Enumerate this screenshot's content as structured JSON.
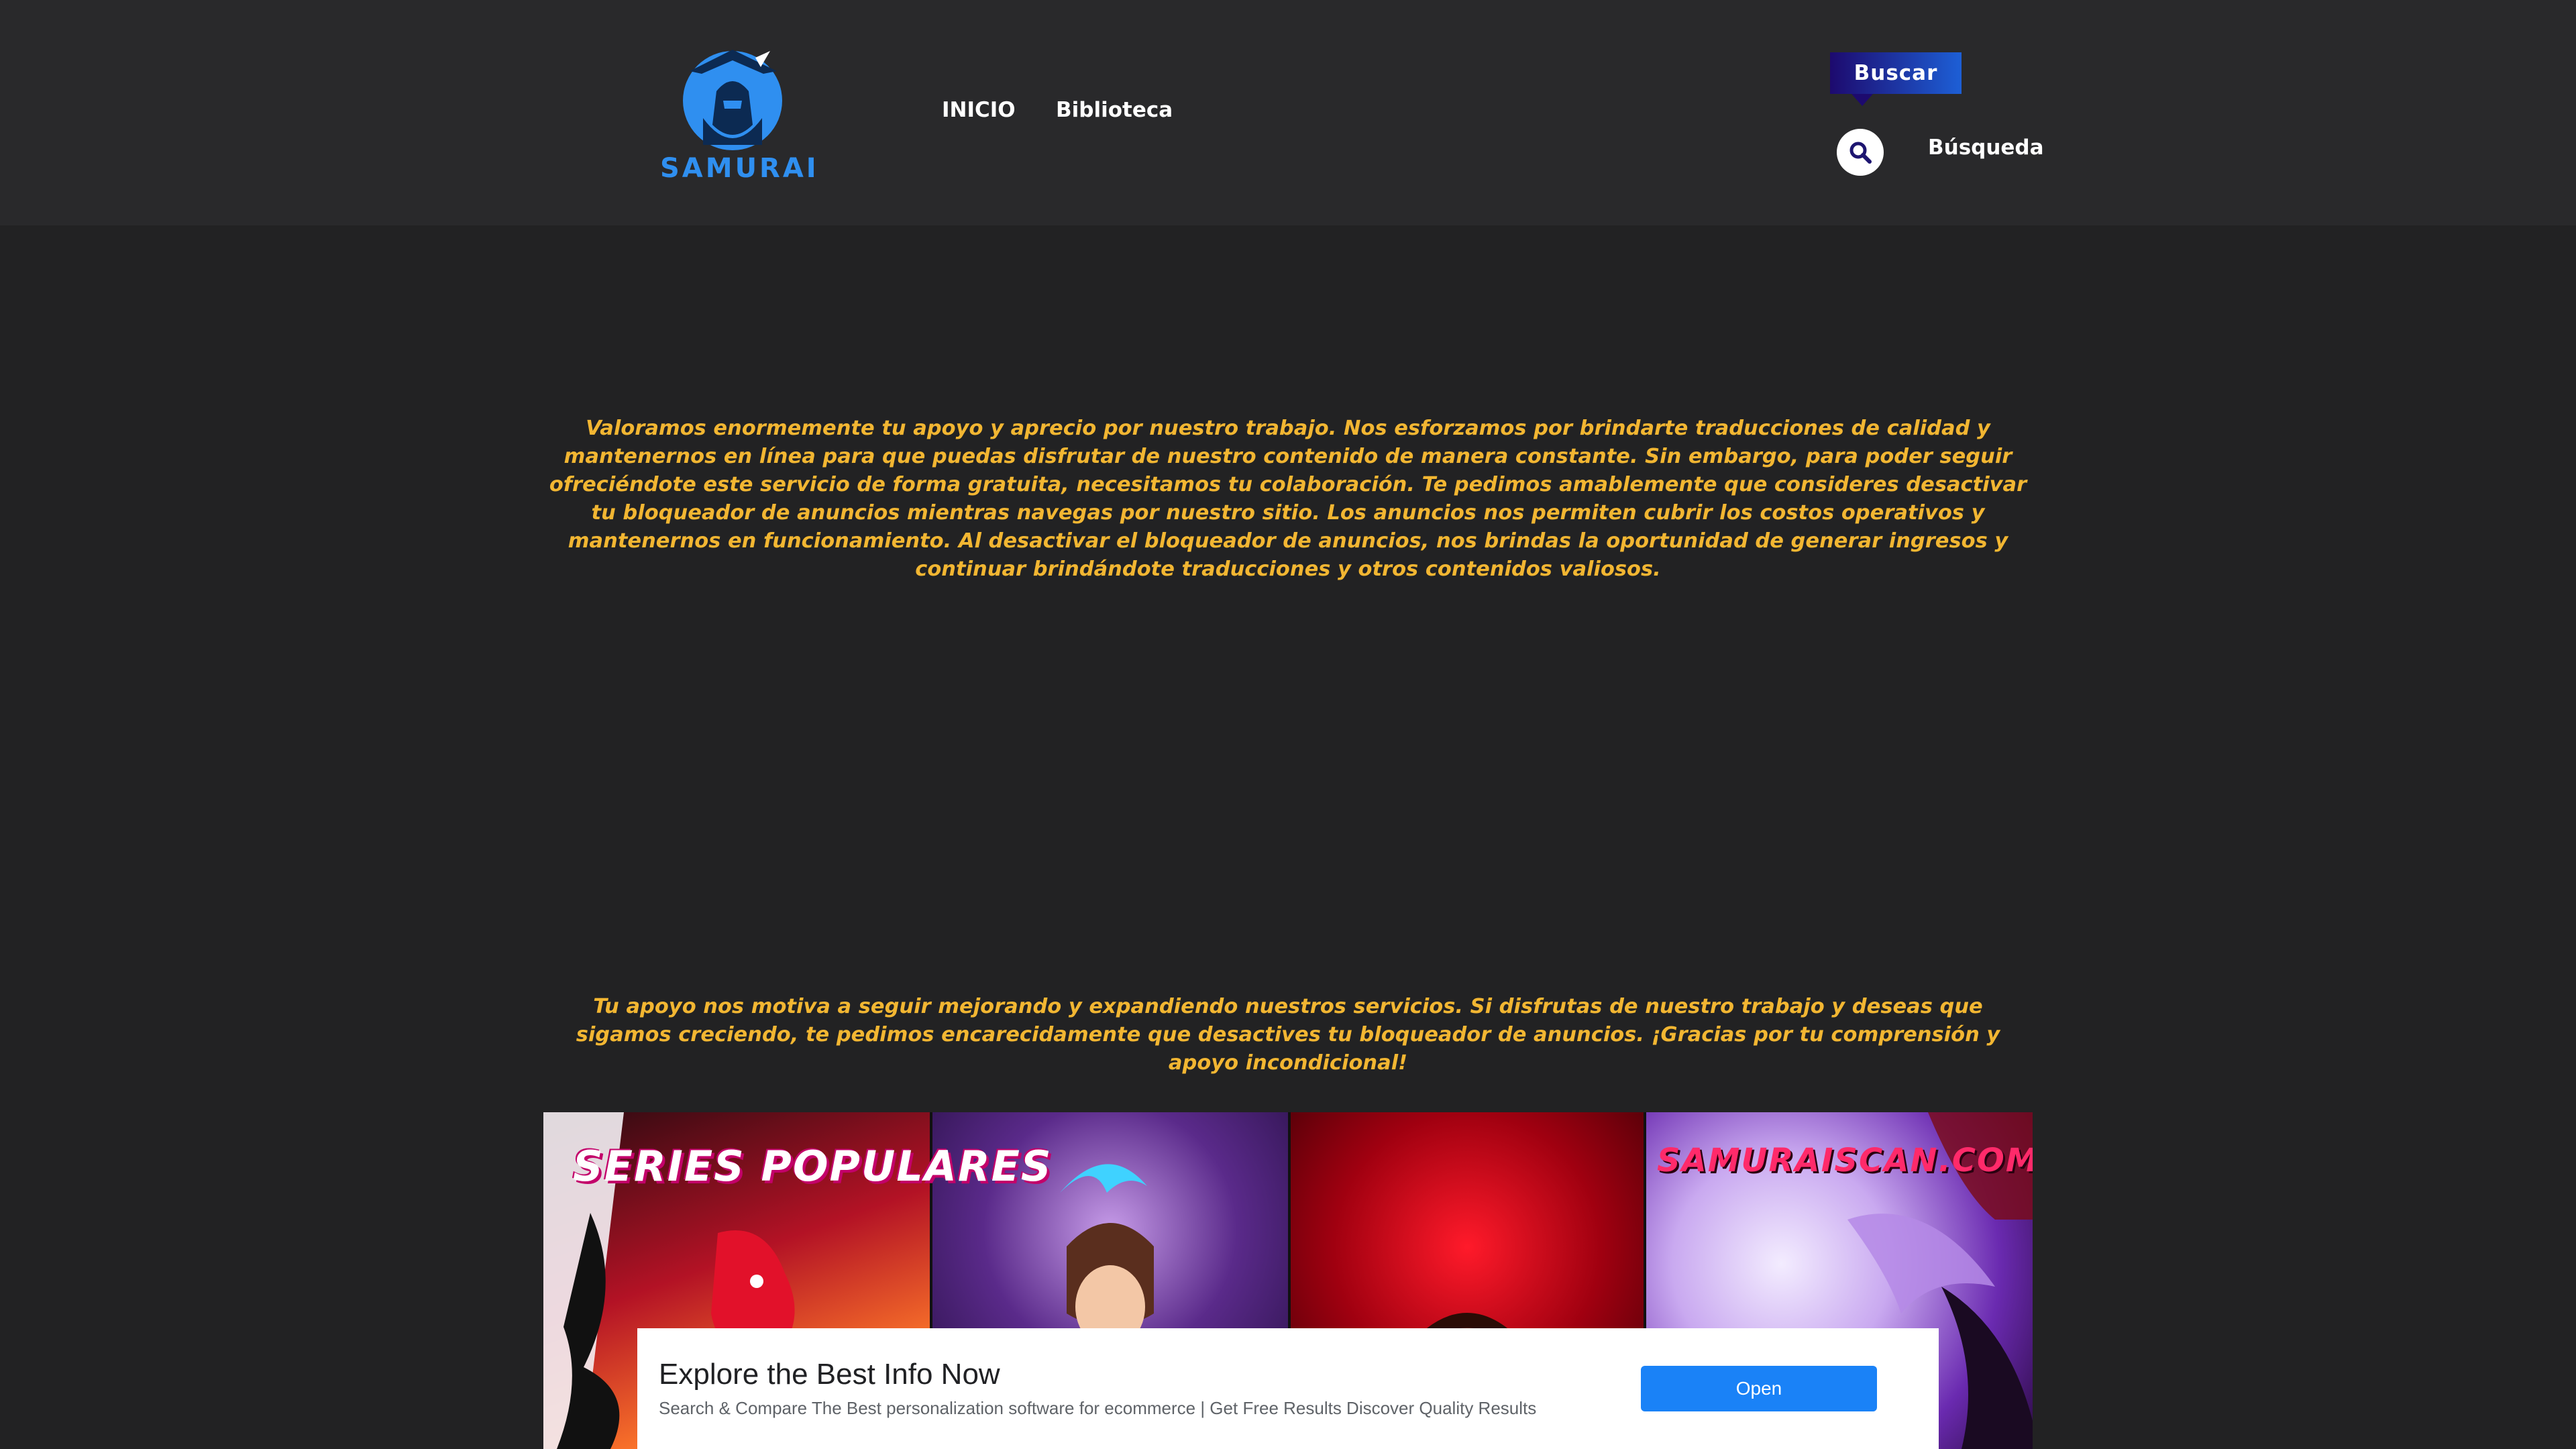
{
  "header": {
    "logo_text": "SAMURAI",
    "nav": [
      {
        "label": "INICIO"
      },
      {
        "label": "Biblioteca"
      }
    ],
    "search": {
      "tooltip": "Buscar",
      "label": "Búsqueda",
      "icon": "search-icon"
    }
  },
  "notice": {
    "paragraph1": "Valoramos enormemente tu apoyo y aprecio por nuestro trabajo. Nos esforzamos por brindarte traducciones de calidad y mantenernos en línea para que puedas disfrutar de nuestro contenido de manera constante. Sin embargo, para poder seguir ofreciéndote este servicio de forma gratuita, necesitamos tu colaboración. Te pedimos amablemente que consideres desactivar tu bloqueador de anuncios mientras navegas por nuestro sitio. Los anuncios nos permiten cubrir los costos operativos y mantenernos en funcionamiento. Al desactivar el bloqueador de anuncios, nos brindas la oportunidad de generar ingresos y continuar brindándote traducciones y otros contenidos valiosos.",
    "paragraph2": "Tu apoyo nos motiva a seguir mejorando y expandiendo nuestros servicios. Si disfrutas de nuestro trabajo y deseas que sigamos creciendo, te pedimos encarecidamente que desactives tu bloqueador de anuncios. ¡Gracias por tu comprensión y apoyo incondicional!"
  },
  "banner": {
    "title_left": "SERIES POPULARES",
    "title_right": "SAMURAISCAN.COM"
  },
  "ad": {
    "title": "Explore the Best Info Now",
    "description": "Search & Compare The Best personalization software for ecommerce | Get Free Results Discover Quality Results",
    "button": "Open"
  },
  "colors": {
    "background": "#222223",
    "header": "#29292b",
    "notice_text": "#f2b632",
    "logo_blue": "#2f8ff0",
    "ad_button": "#1a82f7"
  }
}
